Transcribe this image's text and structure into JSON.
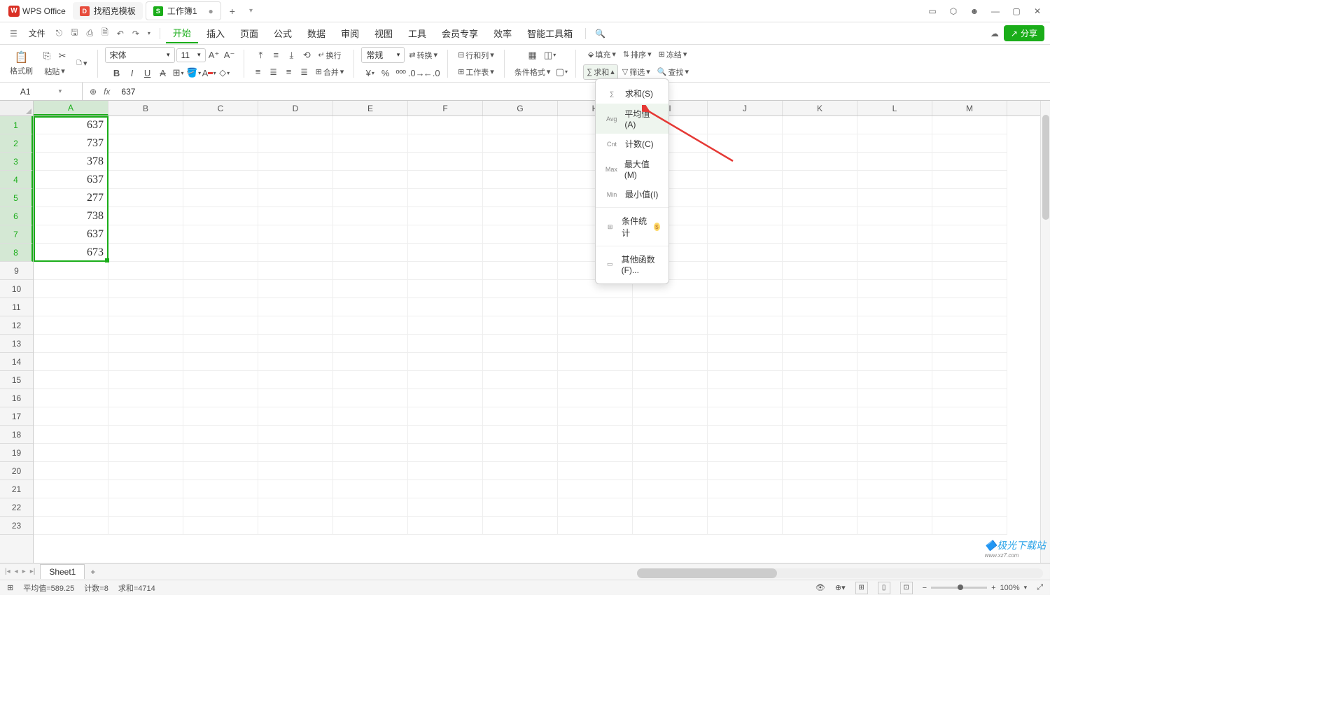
{
  "title": {
    "app": "WPS Office"
  },
  "tabs": [
    {
      "label": "找稻克模板"
    },
    {
      "label": "工作簿1"
    }
  ],
  "file_menu": "文件",
  "menu_tabs": [
    "开始",
    "插入",
    "页面",
    "公式",
    "数据",
    "审阅",
    "视图",
    "工具",
    "会员专享",
    "效率",
    "智能工具箱"
  ],
  "ribbon": {
    "paint": "格式刷",
    "paste": "粘贴",
    "font": "宋体",
    "font_size": "11",
    "num_format": "常规",
    "convert": "转换",
    "row_col": "行和列",
    "worksheet": "工作表",
    "cond_fmt": "条件格式",
    "fill": "填充",
    "sum": "求和",
    "sort": "排序",
    "filter": "筛选",
    "freeze": "冻结",
    "find": "查找",
    "merge": "合并",
    "autowrap": "换行"
  },
  "name_box": "A1",
  "formula": "637",
  "columns": [
    "A",
    "B",
    "C",
    "D",
    "E",
    "F",
    "G",
    "H",
    "I",
    "J",
    "K",
    "L",
    "M"
  ],
  "rows": [
    "1",
    "2",
    "3",
    "4",
    "5",
    "6",
    "7",
    "8",
    "9",
    "10",
    "11",
    "12",
    "13",
    "14",
    "15",
    "16",
    "17",
    "18",
    "19",
    "20",
    "21",
    "22",
    "23"
  ],
  "data_cells": [
    "637",
    "737",
    "378",
    "637",
    "277",
    "738",
    "637",
    "673"
  ],
  "dropdown": {
    "sum": "求和(S)",
    "avg": "平均值(A)",
    "count": "计数(C)",
    "max": "最大值(M)",
    "min": "最小值(I)",
    "cond": "条件统计",
    "other": "其他函数(F)..."
  },
  "dropdown_badges": {
    "sum": "∑",
    "avg": "Avg",
    "count": "Cnt",
    "max": "Max",
    "min": "Min",
    "cond": "⊞",
    "other": "▭"
  },
  "sheet": "Sheet1",
  "status": {
    "avg": "平均值=589.25",
    "count": "计数=8",
    "sum": "求和=4714",
    "zoom": "100%"
  },
  "share": "分享",
  "watermark": "极光下载站",
  "watermark_url": "www.xz7.com"
}
